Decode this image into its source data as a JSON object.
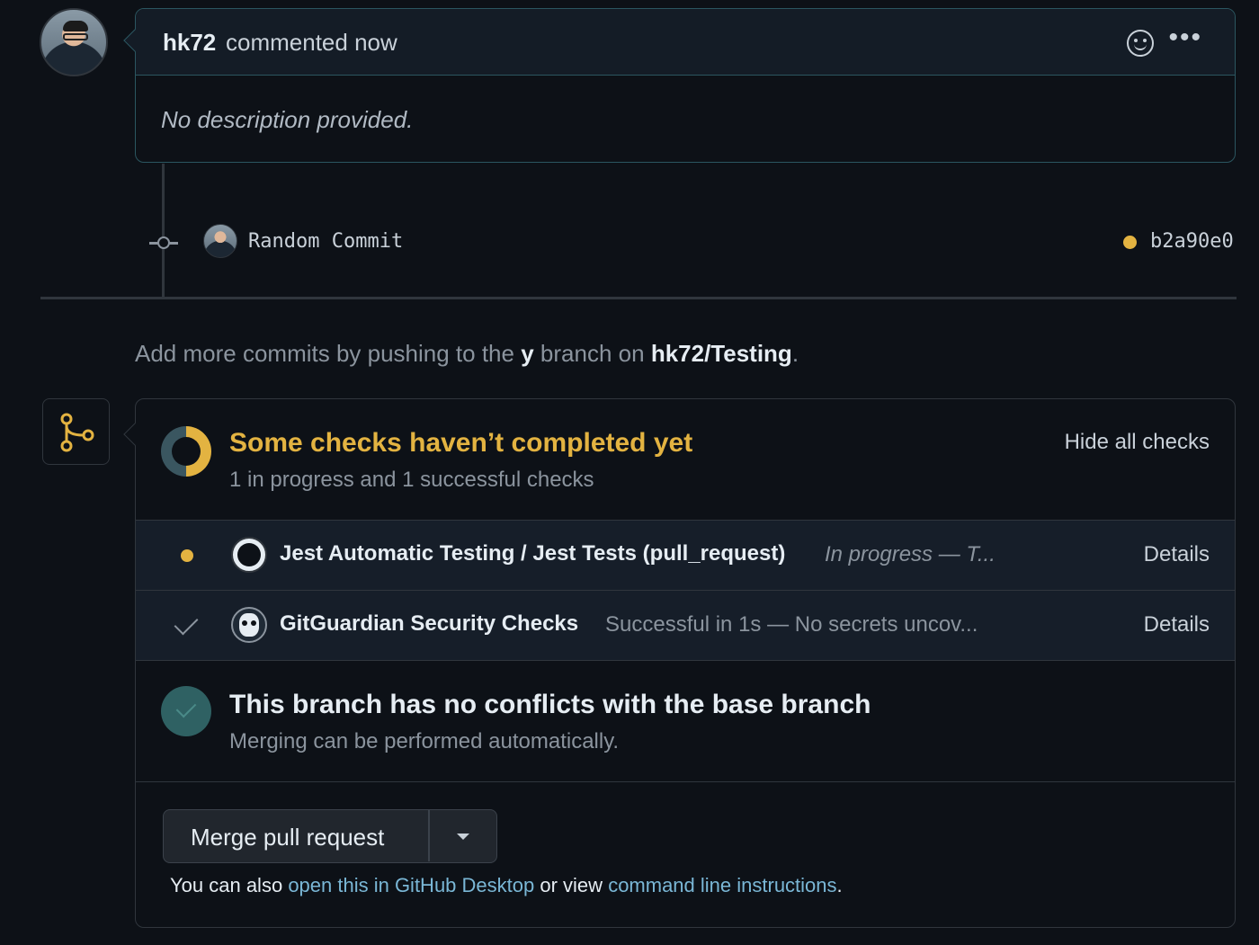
{
  "comment": {
    "author": "hk72",
    "time": "commented now",
    "body": "No description provided.",
    "icons": [
      "smiley-icon",
      "kebab-menu-icon"
    ]
  },
  "commit": {
    "message": "Random Commit",
    "sha": "b2a90e0",
    "status_color": "#e3b341"
  },
  "hint": {
    "prefix": "Add more commits by pushing to the",
    "branch": "y",
    "middle": "branch on",
    "repo": "hk72/Testing",
    "suffix": "."
  },
  "checks": {
    "title": "Some checks haven’t completed yet",
    "subtitle": "1 in progress and 1 successful checks",
    "hide_label": "Hide all checks",
    "items": [
      {
        "name": "Jest Automatic Testing / Jest Tests (pull_request)",
        "status": "In progress — T...",
        "details": "Details",
        "state": "in-progress"
      },
      {
        "name": "GitGuardian Security Checks",
        "status": "Successful in 1s — No secrets uncov...",
        "details": "Details",
        "state": "success"
      }
    ]
  },
  "conflicts": {
    "title": "This branch has no conflicts with the base branch",
    "subtitle": "Merging can be performed automatically."
  },
  "merge": {
    "button_label": "Merge pull request",
    "also_prefix": "You can also",
    "desktop_link": "open this in GitHub Desktop",
    "also_middle": "or view",
    "cli_link": "command line instructions",
    "also_suffix": "."
  },
  "colors": {
    "background": "#0d1117",
    "pending": "#e3b341",
    "success_circle": "#2f6163"
  }
}
